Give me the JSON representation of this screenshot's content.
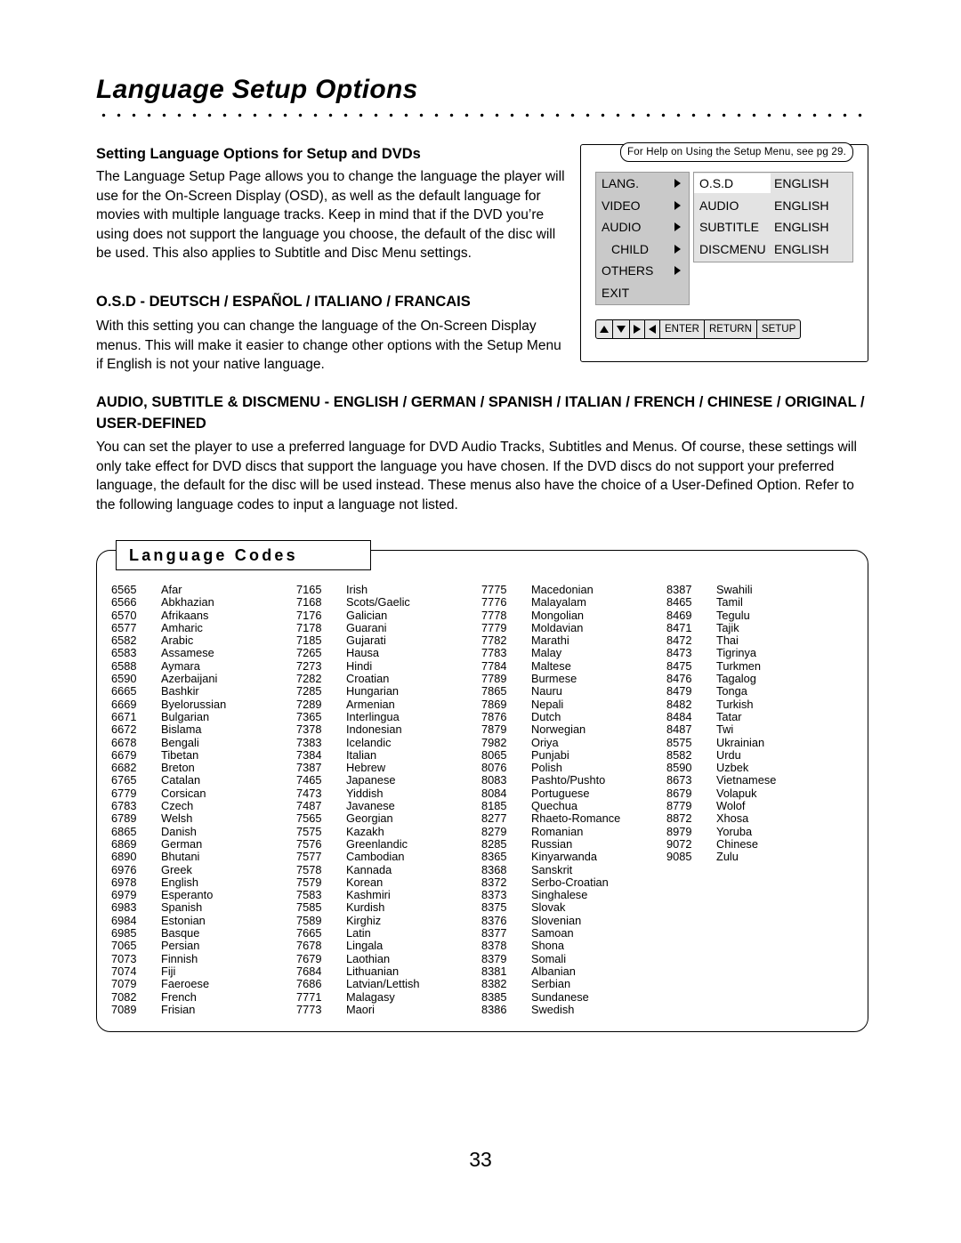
{
  "page": {
    "title": "Language Setup Options",
    "number": "33"
  },
  "intro": {
    "heading": "Setting Language Options for Setup and DVDs",
    "body": "The Language Setup Page allows you to change the language the player will use for the On-Screen Display (OSD), as well as the default language for movies with multiple language tracks. Keep in mind that if the DVD you’re using does not support the language you choose, the default of the disc will be used. This also applies to Subtitle and Disc Menu settings."
  },
  "osd_section": {
    "heading": "O.S.D - DEUTSCH / ESPAÑOL / ITALIANO / FRANCAIS",
    "body": "With this setting you can change the language of the On-Screen Display menus. This will make it easier to change other options with the Setup Menu if English is not your native language."
  },
  "audio_section": {
    "heading": "AUDIO, SUBTITLE & DISCMENU - ENGLISH / GERMAN / SPANISH / ITALIAN / FRENCH / CHINESE / ORIGINAL / USER-DEFINED",
    "body": "You can set the player to use a preferred language for DVD Audio Tracks, Subtitles and Menus. Of course, these settings will only take effect for DVD discs that support the language you have chosen. If the DVD discs do not support your preferred language, the default for the disc will be used instead. These menus also have the choice of a User-Defined Option. Refer to the following language codes to input a language not listed."
  },
  "osd_screen": {
    "help_text": "For Help on Using the Setup Menu, see pg 29.",
    "menu_items": [
      {
        "label": "LANG.",
        "arrow": true,
        "indent": false
      },
      {
        "label": "VIDEO",
        "arrow": true,
        "indent": false
      },
      {
        "label": "AUDIO",
        "arrow": true,
        "indent": false
      },
      {
        "label": "CHILD",
        "arrow": true,
        "indent": true
      },
      {
        "label": "OTHERS",
        "arrow": true,
        "indent": false
      },
      {
        "label": "EXIT",
        "arrow": false,
        "indent": false
      }
    ],
    "settings": [
      {
        "key": "O.S.D",
        "value": "ENGLISH",
        "selected": true
      },
      {
        "key": "AUDIO",
        "value": "ENGLISH",
        "selected": false
      },
      {
        "key": "SUBTITLE",
        "value": "ENGLISH",
        "selected": false
      },
      {
        "key": "DISCMENU",
        "value": "ENGLISH",
        "selected": false
      }
    ],
    "buttons": [
      "ENTER",
      "RETURN",
      "SETUP"
    ],
    "dpad_icons": [
      "up-arrow-icon",
      "down-arrow-icon",
      "right-arrow-icon",
      "left-arrow-icon"
    ]
  },
  "language_codes": {
    "title": "Language Codes",
    "columns": [
      [
        [
          "6565",
          "Afar"
        ],
        [
          "6566",
          "Abkhazian"
        ],
        [
          "6570",
          "Afrikaans"
        ],
        [
          "6577",
          "Amharic"
        ],
        [
          "6582",
          "Arabic"
        ],
        [
          "6583",
          "Assamese"
        ],
        [
          "6588",
          "Aymara"
        ],
        [
          "6590",
          "Azerbaijani"
        ],
        [
          "6665",
          "Bashkir"
        ],
        [
          "6669",
          "Byelorussian"
        ],
        [
          "6671",
          "Bulgarian"
        ],
        [
          "6672",
          "Bislama"
        ],
        [
          "6678",
          "Bengali"
        ],
        [
          "6679",
          "Tibetan"
        ],
        [
          "6682",
          "Breton"
        ],
        [
          "6765",
          "Catalan"
        ],
        [
          "6779",
          "Corsican"
        ],
        [
          "6783",
          "Czech"
        ],
        [
          "6789",
          "Welsh"
        ],
        [
          "6865",
          "Danish"
        ],
        [
          "6869",
          "German"
        ],
        [
          "6890",
          "Bhutani"
        ],
        [
          "6976",
          "Greek"
        ],
        [
          "6978",
          "English"
        ],
        [
          "6979",
          "Esperanto"
        ],
        [
          "6983",
          "Spanish"
        ],
        [
          "6984",
          "Estonian"
        ],
        [
          "6985",
          "Basque"
        ],
        [
          "7065",
          "Persian"
        ],
        [
          "7073",
          "Finnish"
        ],
        [
          "7074",
          "Fiji"
        ],
        [
          "7079",
          "Faeroese"
        ],
        [
          "7082",
          "French"
        ],
        [
          "7089",
          "Frisian"
        ]
      ],
      [
        [
          "7165",
          "Irish"
        ],
        [
          "7168",
          "Scots/Gaelic"
        ],
        [
          "7176",
          "Galician"
        ],
        [
          "7178",
          "Guarani"
        ],
        [
          "7185",
          "Gujarati"
        ],
        [
          "7265",
          "Hausa"
        ],
        [
          "7273",
          "Hindi"
        ],
        [
          "7282",
          "Croatian"
        ],
        [
          "7285",
          "Hungarian"
        ],
        [
          "7289",
          "Armenian"
        ],
        [
          "7365",
          "Interlingua"
        ],
        [
          "7378",
          "Indonesian"
        ],
        [
          "7383",
          "Icelandic"
        ],
        [
          "7384",
          "Italian"
        ],
        [
          "7387",
          "Hebrew"
        ],
        [
          "7465",
          "Japanese"
        ],
        [
          "7473",
          "Yiddish"
        ],
        [
          "7487",
          "Javanese"
        ],
        [
          "7565",
          "Georgian"
        ],
        [
          "7575",
          "Kazakh"
        ],
        [
          "7576",
          "Greenlandic"
        ],
        [
          "7577",
          "Cambodian"
        ],
        [
          "7578",
          "Kannada"
        ],
        [
          "7579",
          "Korean"
        ],
        [
          "7583",
          "Kashmiri"
        ],
        [
          "7585",
          "Kurdish"
        ],
        [
          "7589",
          "Kirghiz"
        ],
        [
          "7665",
          "Latin"
        ],
        [
          "7678",
          "Lingala"
        ],
        [
          "7679",
          "Laothian"
        ],
        [
          "7684",
          "Lithuanian"
        ],
        [
          "7686",
          "Latvian/Lettish"
        ],
        [
          "7771",
          "Malagasy"
        ],
        [
          "7773",
          "Maori"
        ]
      ],
      [
        [
          "7775",
          "Macedonian"
        ],
        [
          "7776",
          "Malayalam"
        ],
        [
          "7778",
          "Mongolian"
        ],
        [
          "7779",
          "Moldavian"
        ],
        [
          "7782",
          "Marathi"
        ],
        [
          "7783",
          "Malay"
        ],
        [
          "7784",
          "Maltese"
        ],
        [
          "7789",
          "Burmese"
        ],
        [
          "7865",
          "Nauru"
        ],
        [
          "7869",
          "Nepali"
        ],
        [
          "7876",
          "Dutch"
        ],
        [
          "7879",
          "Norwegian"
        ],
        [
          "7982",
          "Oriya"
        ],
        [
          "8065",
          "Punjabi"
        ],
        [
          "8076",
          "Polish"
        ],
        [
          "8083",
          "Pashto/Pushto"
        ],
        [
          "8084",
          "Portuguese"
        ],
        [
          "8185",
          "Quechua"
        ],
        [
          "8277",
          "Rhaeto-Romance"
        ],
        [
          "8279",
          "Romanian"
        ],
        [
          "8285",
          "Russian"
        ],
        [
          "8365",
          "Kinyarwanda"
        ],
        [
          "8368",
          "Sanskrit"
        ],
        [
          "8372",
          "Serbo-Croatian"
        ],
        [
          "8373",
          "Singhalese"
        ],
        [
          "8375",
          "Slovak"
        ],
        [
          "8376",
          "Slovenian"
        ],
        [
          "8377",
          "Samoan"
        ],
        [
          "8378",
          "Shona"
        ],
        [
          "8379",
          "Somali"
        ],
        [
          "8381",
          "Albanian"
        ],
        [
          "8382",
          "Serbian"
        ],
        [
          "8385",
          "Sundanese"
        ],
        [
          "8386",
          "Swedish"
        ]
      ],
      [
        [
          "8387",
          "Swahili"
        ],
        [
          "8465",
          "Tamil"
        ],
        [
          "8469",
          "Tegulu"
        ],
        [
          "8471",
          "Tajik"
        ],
        [
          "8472",
          "Thai"
        ],
        [
          "8473",
          "Tigrinya"
        ],
        [
          "8475",
          "Turkmen"
        ],
        [
          "8476",
          "Tagalog"
        ],
        [
          "8479",
          "Tonga"
        ],
        [
          "8482",
          "Turkish"
        ],
        [
          "8484",
          "Tatar"
        ],
        [
          "8487",
          "Twi"
        ],
        [
          "8575",
          "Ukrainian"
        ],
        [
          "8582",
          "Urdu"
        ],
        [
          "8590",
          "Uzbek"
        ],
        [
          "8673",
          "Vietnamese"
        ],
        [
          "8679",
          "Volapuk"
        ],
        [
          "8779",
          "Wolof"
        ],
        [
          "8872",
          "Xhosa"
        ],
        [
          "8979",
          "Yoruba"
        ],
        [
          "9072",
          "Chinese"
        ],
        [
          "9085",
          "Zulu"
        ]
      ]
    ]
  }
}
